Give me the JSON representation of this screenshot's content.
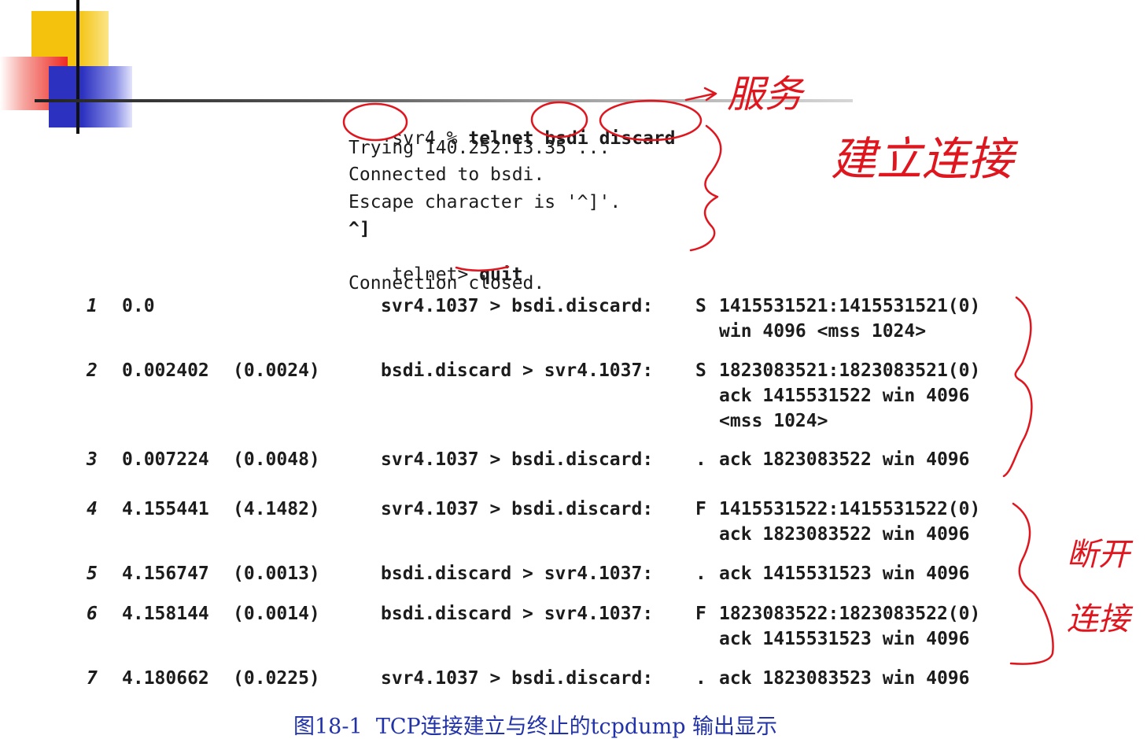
{
  "session": {
    "prompt": "svr4",
    "percent": "%",
    "command": "telnet",
    "host": "bsdi",
    "service": "discard",
    "lines": [
      "Trying 140.252.13.35 ...",
      "Connected to bsdi.",
      "Escape character is '^]'.",
      "^]"
    ],
    "telnet_prompt": "telnet>",
    "quit": "quit",
    "closed": "Connection closed."
  },
  "trace": [
    {
      "num": "1",
      "time": "0.0",
      "delta": "",
      "src": "svr4.1037 > bsdi.discard:",
      "flag": "S",
      "line1": "1415531521:1415531521(0)",
      "cont": [
        "win 4096 <mss 1024>"
      ]
    },
    {
      "num": "2",
      "time": "0.002402",
      "delta": "(0.0024)",
      "src": "bsdi.discard > svr4.1037:",
      "flag": "S",
      "line1": "1823083521:1823083521(0)",
      "cont": [
        "ack 1415531522 win 4096",
        "<mss 1024>"
      ]
    },
    {
      "num": "3",
      "time": "0.007224",
      "delta": "(0.0048)",
      "src": "svr4.1037 > bsdi.discard:",
      "flag": ".",
      "line1": "ack 1823083522 win 4096",
      "cont": []
    },
    {
      "num": "4",
      "time": "4.155441",
      "delta": "(4.1482)",
      "src": "svr4.1037 > bsdi.discard:",
      "flag": "F",
      "line1": "1415531522:1415531522(0)",
      "cont": [
        "ack 1823083522 win 4096"
      ]
    },
    {
      "num": "5",
      "time": "4.156747",
      "delta": "(0.0013)",
      "src": "bsdi.discard > svr4.1037:",
      "flag": ".",
      "line1": "ack 1415531523 win 4096",
      "cont": []
    },
    {
      "num": "6",
      "time": "4.158144",
      "delta": "(0.0014)",
      "src": "bsdi.discard > svr4.1037:",
      "flag": "F",
      "line1": "1823083522:1823083522(0)",
      "cont": [
        "ack 1415531523 win 4096"
      ]
    },
    {
      "num": "7",
      "time": "4.180662",
      "delta": "(0.0225)",
      "src": "svr4.1037 > bsdi.discard:",
      "flag": ".",
      "line1": "ack 1823083523 win 4096",
      "cont": []
    }
  ],
  "caption": "图18-1  TCP连接建立与终止的tcpdump 输出显示",
  "annotations": {
    "service_note": "服务",
    "establish_note": "建立连接",
    "terminate_note_1": "断开",
    "terminate_note_2": "连接"
  },
  "colors": {
    "text": "#1c1c1c",
    "caption": "#2233a8",
    "annotation": "#e0161f",
    "deco_yellow": "#f4c20d",
    "deco_red": "#ee2a22",
    "deco_blue": "#3a40c8"
  }
}
